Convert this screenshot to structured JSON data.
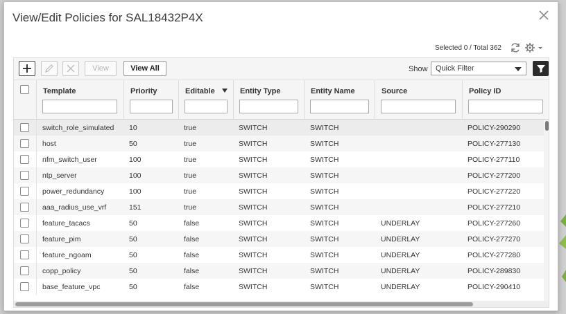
{
  "dialog": {
    "title": "View/Edit Policies for SAL18432P4X",
    "selected_text": "Selected 0 / Total 362"
  },
  "toolbar": {
    "view_label": "View",
    "view_all_label": "View All",
    "show_label": "Show",
    "filter_value": "Quick Filter"
  },
  "table": {
    "columns": [
      "Template",
      "Priority",
      "Editable",
      "Entity Type",
      "Entity Name",
      "Source",
      "Policy ID"
    ],
    "rows": [
      {
        "template": "switch_role_simulated",
        "priority": "10",
        "editable": "true",
        "entity_type": "SWITCH",
        "entity_name": "SWITCH",
        "source": "",
        "policy_id": "POLICY-290290"
      },
      {
        "template": "host",
        "priority": "50",
        "editable": "true",
        "entity_type": "SWITCH",
        "entity_name": "SWITCH",
        "source": "",
        "policy_id": "POLICY-277130"
      },
      {
        "template": "nfm_switch_user",
        "priority": "100",
        "editable": "true",
        "entity_type": "SWITCH",
        "entity_name": "SWITCH",
        "source": "",
        "policy_id": "POLICY-277110"
      },
      {
        "template": "ntp_server",
        "priority": "100",
        "editable": "true",
        "entity_type": "SWITCH",
        "entity_name": "SWITCH",
        "source": "",
        "policy_id": "POLICY-277200"
      },
      {
        "template": "power_redundancy",
        "priority": "100",
        "editable": "true",
        "entity_type": "SWITCH",
        "entity_name": "SWITCH",
        "source": "",
        "policy_id": "POLICY-277220"
      },
      {
        "template": "aaa_radius_use_vrf",
        "priority": "151",
        "editable": "true",
        "entity_type": "SWITCH",
        "entity_name": "SWITCH",
        "source": "",
        "policy_id": "POLICY-277210"
      },
      {
        "template": "feature_tacacs",
        "priority": "50",
        "editable": "false",
        "entity_type": "SWITCH",
        "entity_name": "SWITCH",
        "source": "UNDERLAY",
        "policy_id": "POLICY-277260"
      },
      {
        "template": "feature_pim",
        "priority": "50",
        "editable": "false",
        "entity_type": "SWITCH",
        "entity_name": "SWITCH",
        "source": "UNDERLAY",
        "policy_id": "POLICY-277270"
      },
      {
        "template": "feature_ngoam",
        "priority": "50",
        "editable": "false",
        "entity_type": "SWITCH",
        "entity_name": "SWITCH",
        "source": "UNDERLAY",
        "policy_id": "POLICY-277280"
      },
      {
        "template": "copp_policy",
        "priority": "50",
        "editable": "false",
        "entity_type": "SWITCH",
        "entity_name": "SWITCH",
        "source": "UNDERLAY",
        "policy_id": "POLICY-289830"
      },
      {
        "template": "base_feature_vpc",
        "priority": "50",
        "editable": "false",
        "entity_type": "SWITCH",
        "entity_name": "SWITCH",
        "source": "UNDERLAY",
        "policy_id": "POLICY-290410"
      }
    ]
  },
  "icons": {
    "close": "close-icon",
    "refresh": "refresh-icon",
    "settings": "gear-icon",
    "add": "plus-icon",
    "edit": "pencil-icon",
    "delete": "x-icon",
    "filter": "funnel-icon"
  },
  "colors": {
    "filter_button": "#2b2b2b",
    "header_bg": "#f5f5f5"
  }
}
